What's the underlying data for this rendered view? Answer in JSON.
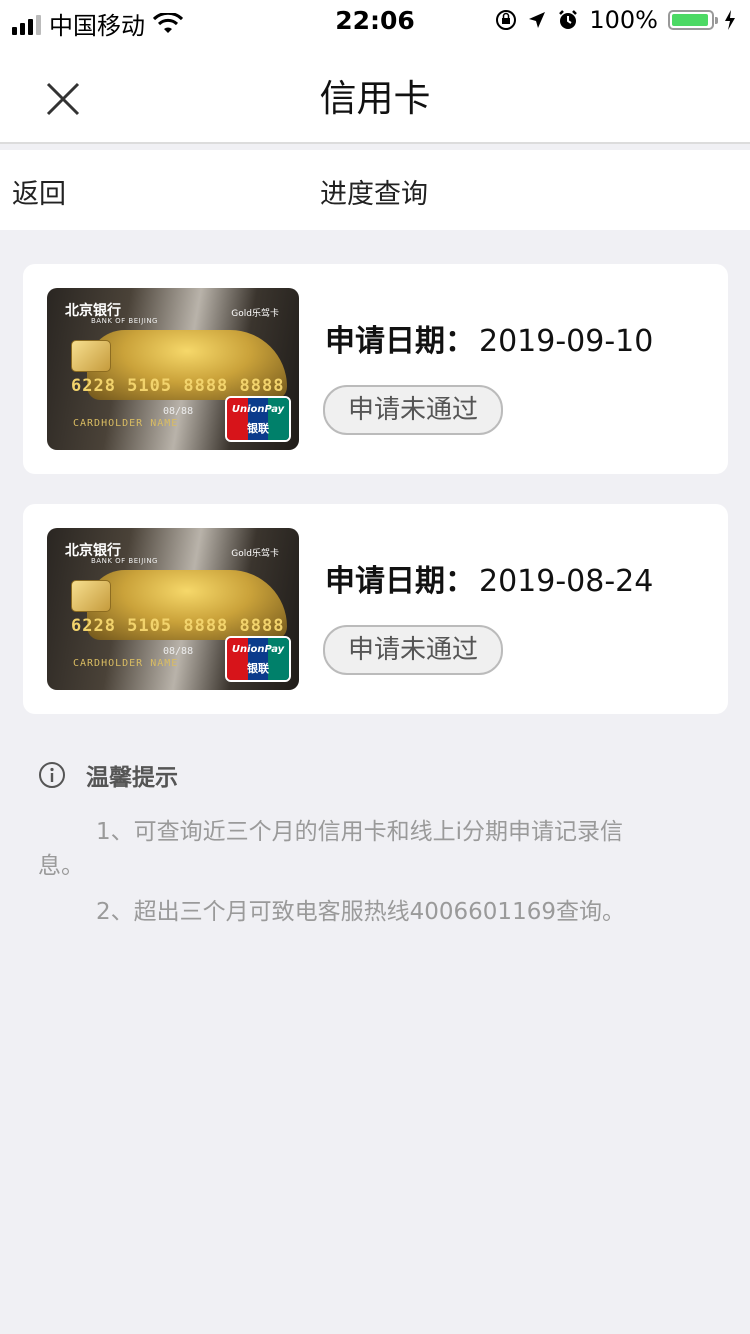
{
  "status_bar": {
    "carrier": "中国移动",
    "time": "22:06",
    "battery_pct": "100%"
  },
  "nav": {
    "title": "信用卡"
  },
  "subbar": {
    "back_label": "返回",
    "progress_label": "进度查询"
  },
  "applications": [
    {
      "date_label": "申请日期：",
      "date": "2019-09-10",
      "status": "申请未通过",
      "card": {
        "bank_name": "北京银行",
        "bank_en": "BANK OF BEIJING",
        "product": "Gold乐驾卡",
        "number": "6228 5105 8888 8888",
        "expiry": "08/88",
        "holder": "CARDHOLDER NAME",
        "network": "UnionPay",
        "network_cn": "银联"
      }
    },
    {
      "date_label": "申请日期：",
      "date": "2019-08-24",
      "status": "申请未通过",
      "card": {
        "bank_name": "北京银行",
        "bank_en": "BANK OF BEIJING",
        "product": "Gold乐驾卡",
        "number": "6228 5105 8888 8888",
        "expiry": "08/88",
        "holder": "CARDHOLDER NAME",
        "network": "UnionPay",
        "network_cn": "银联"
      }
    }
  ],
  "tips": {
    "title": "温馨提示",
    "items": [
      "1、可查询近三个月的信用卡和线上i分期申请记录信息。",
      "2、超出三个月可致电客服热线4006601169查询。"
    ]
  },
  "icons": {
    "close": "close-icon",
    "info": "info-icon",
    "wifi": "wifi-icon",
    "battery": "battery-icon"
  },
  "colors": {
    "background": "#f0f0f4",
    "battery_fill": "#4cd964",
    "badge_border": "#bbbbbb",
    "tip_text": "#9a9a9a"
  }
}
